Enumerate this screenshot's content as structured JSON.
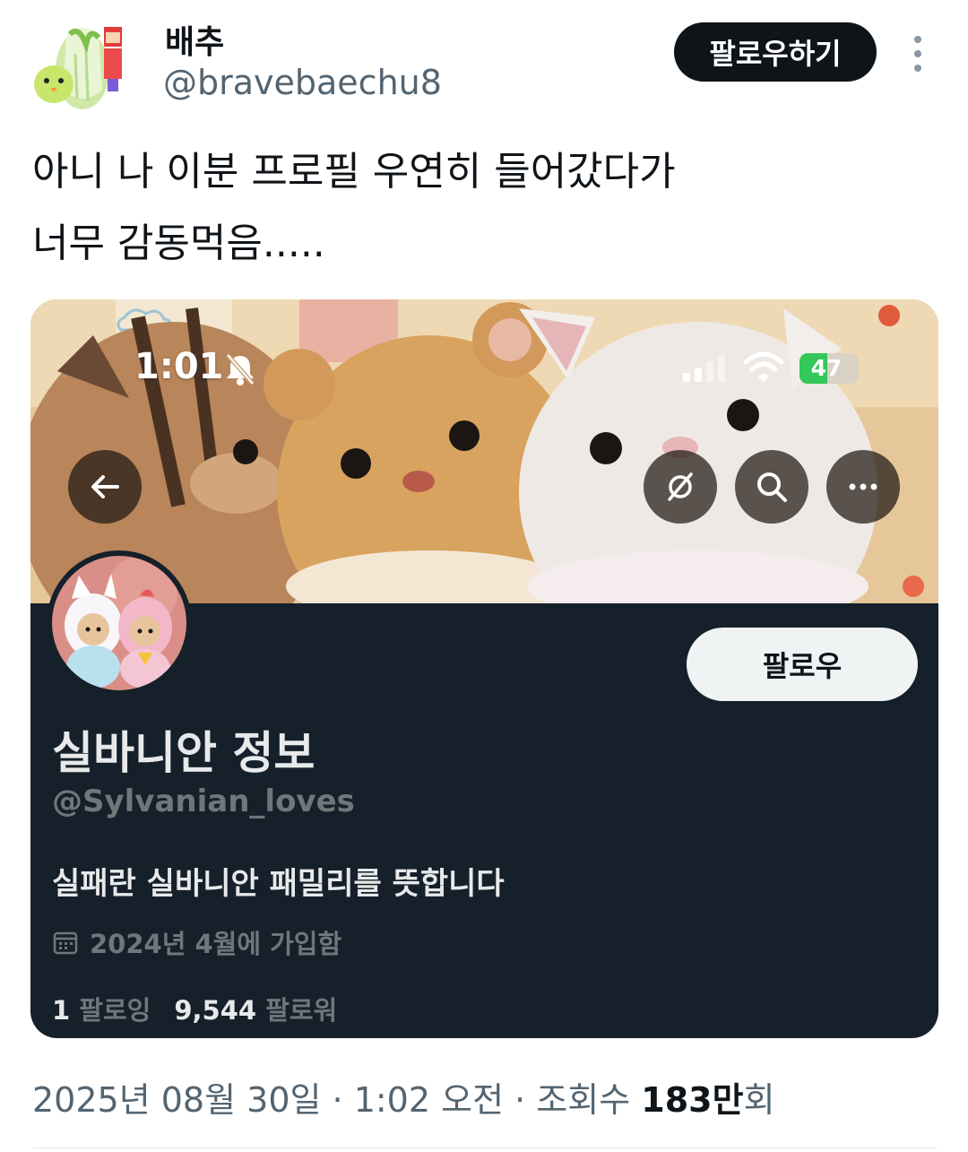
{
  "tweet": {
    "author_name": "배추",
    "author_handle": "@bravebaechu8",
    "follow_label": "팔로우하기",
    "text_line1": "아니 나 이분 프로필 우연히 들어갔다가",
    "text_line2": "너무 감동먹음.....",
    "meta": {
      "date": "2025년 08월 30일",
      "sep1": " · ",
      "time": "1:02 오전",
      "sep2": " · ",
      "views_label": "조회수 ",
      "views_num": "183만",
      "views_suffix": "회"
    }
  },
  "screenshot": {
    "status_time": "1:01",
    "battery_level": "47",
    "battery_fraction": 0.47,
    "profile": {
      "follow_label": "팔로우",
      "name": "실바니안 정보",
      "handle": "@Sylvanian_loves",
      "bio": "실패란 실바니안 패밀리를 뜻합니다",
      "joined": "2024년 4월에 가입함",
      "following_count": "1",
      "following_label": "팔로잉",
      "followers_count": "9,544",
      "followers_label": "팔로워"
    }
  },
  "icons": {
    "more": "more-vertical-icon",
    "bell": "bell-muted-icon",
    "back": "arrow-left-icon",
    "translate": "translate-icon",
    "search": "search-icon",
    "menu": "more-horizontal-icon",
    "calendar": "calendar-icon"
  },
  "colors": {
    "follow_button_bg": "#0f1419",
    "card_bg": "#15202b",
    "secondary_text": "#536471",
    "battery_green": "#34c759"
  }
}
